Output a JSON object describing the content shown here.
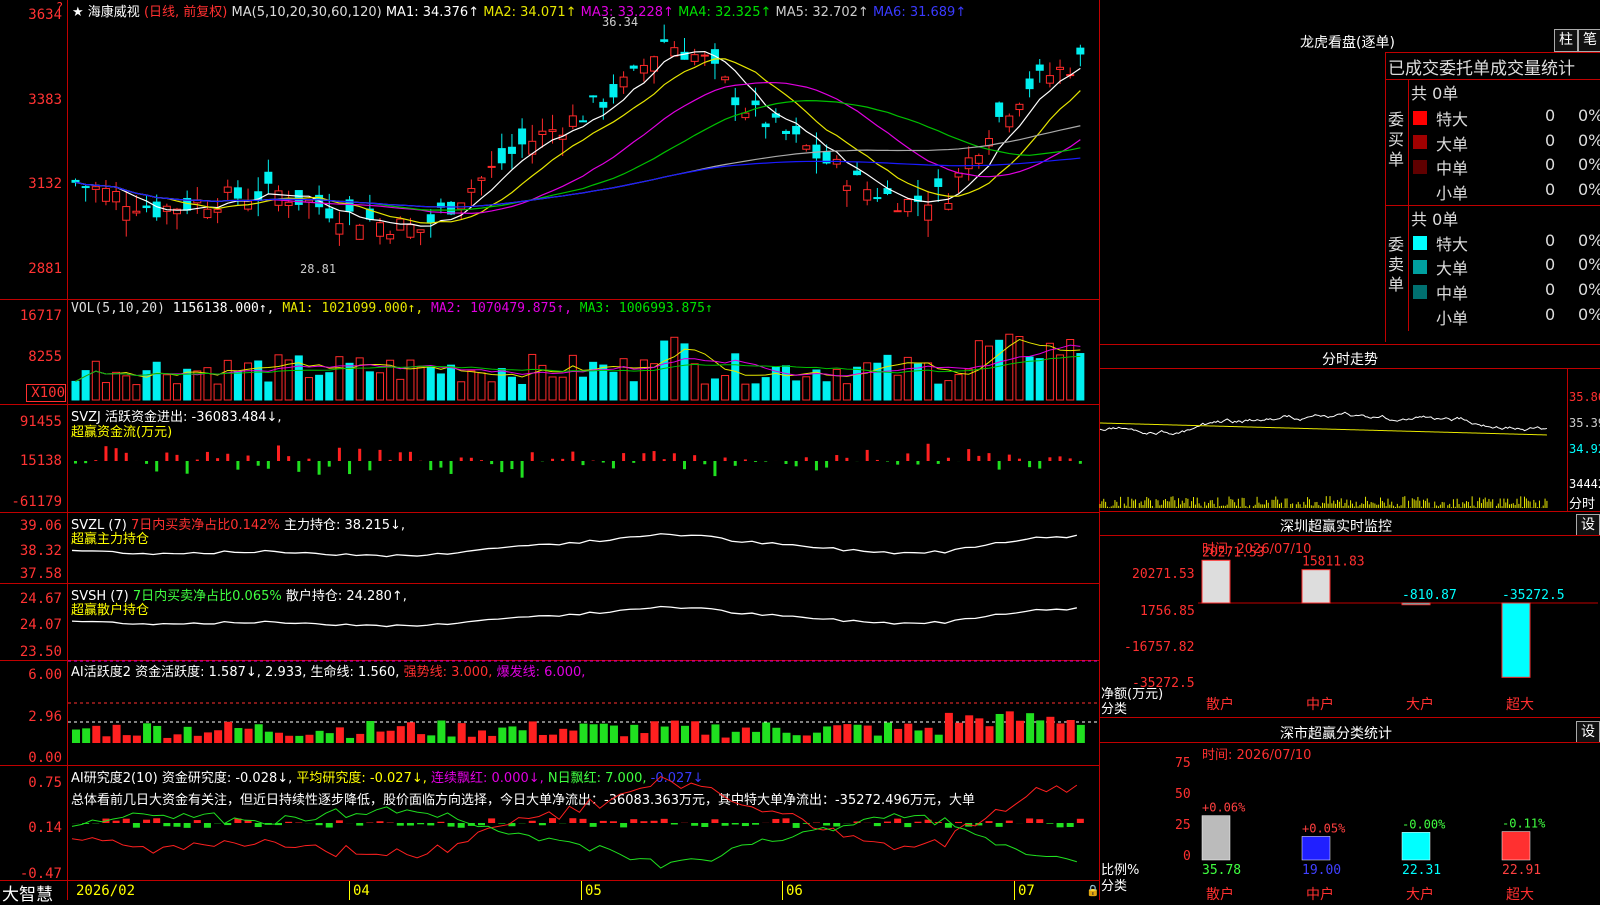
{
  "app": {
    "name": "大智慧",
    "lock_icon": "lock-icon"
  },
  "colors": {
    "up": "#ff2a2a",
    "down": "#00f0f0",
    "grid": "#c00000",
    "ma1": "#ffffff",
    "ma2": "#e6e600",
    "ma3": "#e000e0",
    "ma4": "#00c000",
    "ma5": "#aaaaaa",
    "ma6": "#1a1aff"
  },
  "main": {
    "star": "★",
    "stock": "海康威视",
    "period": "(日线, 前复权)",
    "ma_params": "MA(5,10,20,30,60,120)",
    "ma1": "MA1: 34.376↑",
    "ma2": "MA2: 34.071↑",
    "ma3": "MA3: 33.228↑",
    "ma4": "MA4: 32.325↑",
    "ma5": "MA5: 32.702↑",
    "ma6": "MA6: 31.689↑",
    "high_marker": "36.34",
    "low_marker": "28.81",
    "y_ticks": [
      "3634",
      "3383",
      "3132",
      "2881"
    ],
    "price_range": [
      28.2,
      36.5
    ],
    "marker_1": "?"
  },
  "vol": {
    "label": "VOL(5,10,20)",
    "value": "1156138.000↑,",
    "ma1": "MA1: 1021099.000↑,",
    "ma2": "MA2: 1070479.875↑,",
    "ma3": "MA3: 1006993.875↑",
    "y_ticks": [
      "16717",
      "8255",
      "X100"
    ],
    "max": 18500
  },
  "svzj": {
    "label": "SVZJ",
    "title": "活跃资金进出: -36083.484↓,",
    "subtitle": "超赢资金流(万元)",
    "y_ticks": [
      "91455",
      "15138",
      "-61179"
    ]
  },
  "svzl": {
    "label": "SVZL (7)",
    "red_text": "7日内买卖净占比0.142%",
    "hold": "主力持仓: 38.215↓,",
    "subtitle": "超赢主力持仓",
    "y_ticks": [
      "39.06",
      "38.32",
      "37.58"
    ]
  },
  "svsh": {
    "label": "SVSH (7)",
    "green_text": "7日内买卖净占比0.065%",
    "hold": "散户持仓: 24.280↑,",
    "subtitle": "超赢散户持仓",
    "y_ticks": [
      "24.67",
      "24.07",
      "23.50"
    ]
  },
  "ai1": {
    "label": "AI活跃度2",
    "act": "资金活跃度: 1.587↓,",
    "v2": "2.933,",
    "life": "生命线: 1.560,",
    "strong": "强势线: 3.000,",
    "burst": "爆发线: 6.000,",
    "y_ticks": [
      "6.00",
      "2.96",
      "0.00"
    ]
  },
  "ai2": {
    "label": "AI研究度2(10)",
    "research": "资金研究度: -0.028↓,",
    "avg": "平均研究度: -0.027↓,",
    "red": "连续飘红: 0.000↓,",
    "nday": "N日飘红: 7.000,",
    "last": "-0.027↓",
    "summary": "总体看前几日大资金有关注，但近日持续性逐步降低，股价面临方向选择，今日大单净流出：-36083.363万元，其中特大单净流出：-35272.496万元，大单",
    "y_ticks": [
      "0.75",
      "0.14",
      "-0.47"
    ]
  },
  "xaxis": [
    "2026/02",
    "04",
    "05",
    "06",
    "07"
  ],
  "right": {
    "lhb_title": "龙虎看盘(逐单)",
    "btn_bar": "柱",
    "btn_pen": "笔",
    "lhb_header": "已成交委托单成交量统计",
    "buy_title": "委买单",
    "sell_title": "委卖单",
    "buy_total": "共 0单",
    "sell_total": "共 0单",
    "buy_rows": [
      {
        "name": "特大",
        "count": "0",
        "pct": "0%",
        "color": "#ff0000"
      },
      {
        "name": "大单",
        "count": "0",
        "pct": "0%",
        "color": "#a00000"
      },
      {
        "name": "中单",
        "count": "0",
        "pct": "0%",
        "color": "#600000"
      },
      {
        "name": "小单",
        "count": "0",
        "pct": "0%",
        "color": ""
      }
    ],
    "sell_rows": [
      {
        "name": "特大",
        "count": "0",
        "pct": "0%",
        "color": "#00ffff"
      },
      {
        "name": "大单",
        "count": "0",
        "pct": "0%",
        "color": "#00a0a0"
      },
      {
        "name": "中单",
        "count": "0",
        "pct": "0%",
        "color": "#007070"
      },
      {
        "name": "小单",
        "count": "0",
        "pct": "0%",
        "color": ""
      }
    ],
    "intraday_title": "分时走势",
    "intraday_ticks": [
      "35.86",
      "35.39",
      "34.92",
      "34442",
      "分时"
    ],
    "sz_title": "深圳超赢实时监控",
    "sz_btn": "设",
    "sz_time": "时间: 2026/07/10",
    "sz_yticks": [
      "20271.53",
      "1756.85",
      "-16757.82",
      "-35272.5"
    ],
    "sz_net": "净额(万元)",
    "sz_cat": "分类",
    "sz_bars": [
      {
        "name": "散户",
        "value": 20271.53,
        "label": "20271.53"
      },
      {
        "name": "中户",
        "value": 15811.83,
        "label": "15811.83"
      },
      {
        "name": "大户",
        "value": -810.87,
        "label": "-810.87"
      },
      {
        "name": "超大",
        "value": -35272.5,
        "label": "-35272.5"
      }
    ],
    "cls_title": "深市超赢分类统计",
    "cls_btn": "设",
    "cls_time": "时间: 2026/07/10",
    "cls_yticks": [
      "75",
      "50",
      "25",
      "0"
    ],
    "cls_ratio": "比例%",
    "cls_cat": "分类",
    "cls_bars": [
      {
        "name": "散户",
        "value": 35.78,
        "label": "35.78",
        "delta": "+0.06%",
        "color": "#bbbbbb",
        "delta_color": "#ff4040",
        "val_color": "#40ff40"
      },
      {
        "name": "中户",
        "value": 19.0,
        "label": "19.00",
        "delta": "+0.05%",
        "color": "#2020ff",
        "delta_color": "#ff4040",
        "val_color": "#4040ff"
      },
      {
        "name": "大户",
        "value": 22.31,
        "label": "22.31",
        "delta": "-0.00%",
        "color": "#00ffff",
        "delta_color": "#40ff40",
        "val_color": "#00ffff"
      },
      {
        "name": "超大",
        "value": 22.91,
        "label": "22.91",
        "delta": "-0.11%",
        "color": "#ff3030",
        "delta_color": "#40ff40",
        "val_color": "#ff4040"
      }
    ]
  }
}
